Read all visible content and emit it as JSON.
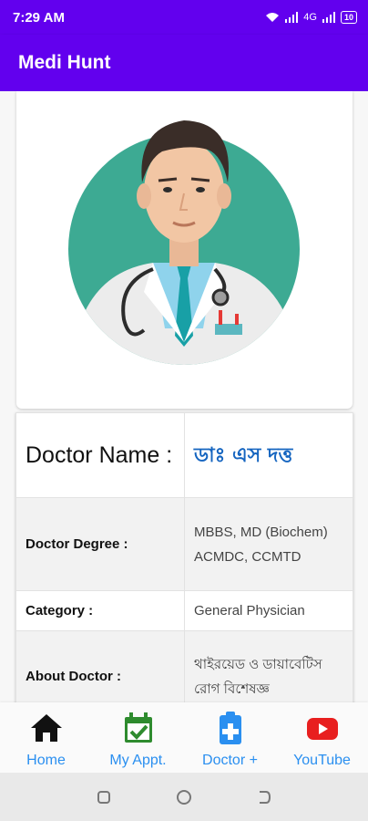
{
  "status_bar": {
    "time": "7:29 AM",
    "network": "4G",
    "battery": "10"
  },
  "app_bar": {
    "title": "Medi Hunt"
  },
  "doctor_image": {
    "alt": "Doctor illustration"
  },
  "details": [
    {
      "label": "Doctor Name :",
      "value": "ডাঃ এস দত্ত"
    },
    {
      "label": "Doctor Degree :",
      "value": "MBBS, MD (Biochem) ACMDC, CCMTD"
    },
    {
      "label": "Category :",
      "value": "General Physician"
    },
    {
      "label": "About Doctor :",
      "value": "থাইরয়েড ও ডায়াবেটিস রোগ বিশেষজ্ঞ"
    }
  ],
  "bottom_nav": [
    {
      "label": "Home",
      "icon": "home-icon"
    },
    {
      "label": "My Appt.",
      "icon": "calendar-check-icon"
    },
    {
      "label": "Doctor +",
      "icon": "clipboard-plus-icon"
    },
    {
      "label": "YouTube",
      "icon": "youtube-icon"
    }
  ],
  "colors": {
    "primary": "#6200ee",
    "nav_label": "#2a8ff0",
    "doctor_name": "#1565c0",
    "avatar_bg": "#3daa93"
  }
}
